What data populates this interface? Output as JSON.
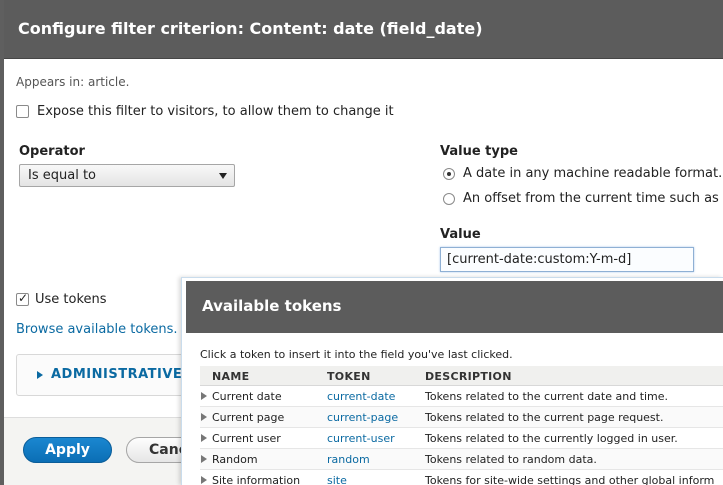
{
  "dialog": {
    "title": "Configure filter criterion: Content: date (field_date)",
    "appears_in": "Appears in: article.",
    "expose_label": "Expose this filter to visitors, to allow them to change it",
    "expose_checked": false,
    "operator": {
      "label": "Operator",
      "selected": "Is equal to"
    },
    "value_type": {
      "label": "Value type",
      "options": [
        {
          "label": "A date in any machine readable format.",
          "checked": true
        },
        {
          "label": "An offset from the current time such as \"",
          "checked": false
        }
      ]
    },
    "value": {
      "label": "Value",
      "input": "[current-date:custom:Y-m-d]"
    },
    "use_tokens_label": "Use tokens",
    "use_tokens_checked": true,
    "browse_link": "Browse available tokens.",
    "admin_section": "ADMINISTRATIVE T",
    "buttons": {
      "apply": "Apply",
      "cancel": "Cance"
    }
  },
  "tokens_dialog": {
    "title": "Available tokens",
    "instruction": "Click a token to insert it into the field you've last clicked.",
    "columns": [
      "NAME",
      "TOKEN",
      "DESCRIPTION"
    ],
    "rows": [
      {
        "name": "Current date",
        "token": "current-date",
        "description": "Tokens related to the current date and time."
      },
      {
        "name": "Current page",
        "token": "current-page",
        "description": "Tokens related to the current page request."
      },
      {
        "name": "Current user",
        "token": "current-user",
        "description": "Tokens related to the currently logged in user."
      },
      {
        "name": "Random",
        "token": "random",
        "description": "Tokens related to random data."
      },
      {
        "name": "Site information",
        "token": "site",
        "description": "Tokens for site-wide settings and other global inform"
      }
    ]
  },
  "colors": {
    "titlebar": "#5c5c5c",
    "link": "#0b6aa2",
    "primary_button": "#0b6eb5"
  }
}
